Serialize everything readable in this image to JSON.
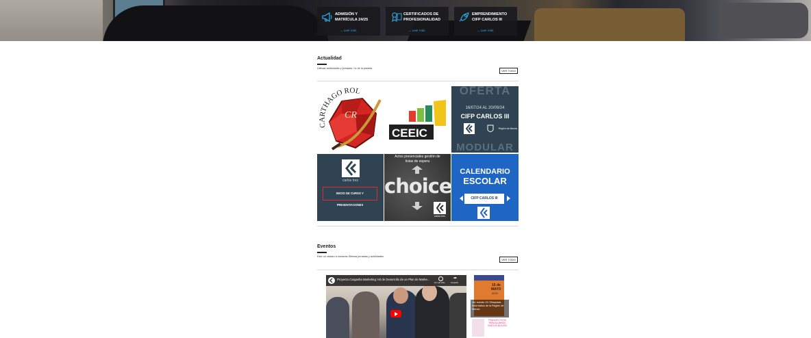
{
  "hero": {
    "cards": [
      {
        "title_line1": "ADMISIÓN Y",
        "title_line2": "MATRÍCULA 24/25",
        "link": "→ Leer más",
        "icon": "megaphone-icon"
      },
      {
        "title_line1": "CERTIFICADOS DE",
        "title_line2": "PROFESIONALIDAD",
        "link": "→ Leer más",
        "icon": "certificate-icon"
      },
      {
        "title_line1": "EMPRENDIMIENTO",
        "title_line2": "CIFP CARLOS III",
        "link": "→ Leer más",
        "icon": "rocket-icon"
      }
    ]
  },
  "actualidad": {
    "title": "Actualidad",
    "subtitle": "Últimas actividades y jornadas / lo de la planeta",
    "button": "VER TODO",
    "tiles": {
      "carthago": {
        "arc_text": "CARTHAGO ROL",
        "monogram": "CR"
      },
      "ceeic": {
        "logo_text": "CEEIC"
      },
      "oferta": {
        "top_text": "OFERTA",
        "dates": "16/07/24 AL 20/09/24",
        "school": "CIFP CARLOS III",
        "region": "Región de Murcia",
        "bottom_text": "MODULAR"
      },
      "inicio": {
        "brand": "carlos tres",
        "label": "INICIO DE CURSO Y PRESENTACIONES"
      },
      "choice": {
        "caption_line1": "Actos presenciales gestión de",
        "caption_line2": "listas de espera",
        "word": "choice",
        "brand": "carlos tres"
      },
      "calendario": {
        "line1": "CALENDARIO",
        "line2": "ESCOLAR",
        "badge": "CIFP CARLOS III"
      }
    }
  },
  "eventos": {
    "title": "Eventos",
    "subtitle": "Este un vistazo a nuestras Últimas jornadas y actividades",
    "button": "VER TODO",
    "video": {
      "title": "Proyecto Cargasha Marketing: Kit de Desarrollo de un Plan de Marke...",
      "ctrl_watch_later": "Ver más tarde",
      "ctrl_share": "Compartir"
    },
    "thumb1": {
      "date_day": "15 de",
      "date_month": "MAYO",
      "date_year": "2024",
      "caption": "Ver evento XV Olimpiada Informática de la Región de Murcia"
    },
    "thumb2": {
      "text": "FRANCÉS FICHA PARA ALUMNOS NUEVOS MOCIÓN"
    }
  },
  "colors": {
    "accent": "#29a8e0",
    "dark_tile": "#2f4352",
    "calendar_blue": "#1f66c4"
  }
}
